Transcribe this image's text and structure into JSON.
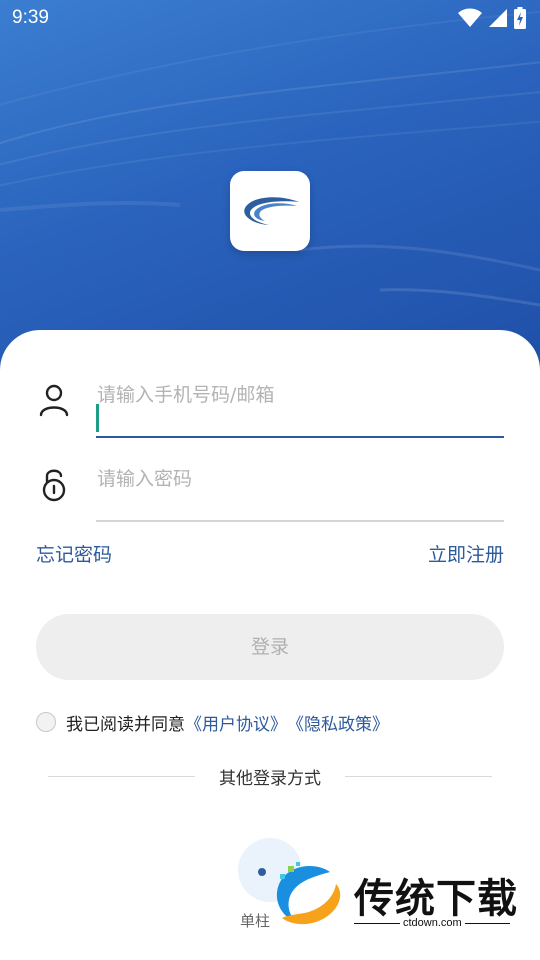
{
  "status_bar": {
    "time": "9:39"
  },
  "login": {
    "account_placeholder": "请输入手机号码/邮箱",
    "password_placeholder": "请输入密码",
    "forgot_password": "忘记密码",
    "register": "立即注册",
    "login_button": "登录",
    "agreement_prefix": "我已阅读并同意",
    "user_agreement": "《用户协议》",
    "privacy_policy": "《隐私政策》",
    "other_methods": "其他登录方式",
    "other_method_label": "单柱"
  },
  "watermark": {
    "brand": "传统下载",
    "domain": "ctdown.com"
  },
  "colors": {
    "primary": "#2d5a9c",
    "hero_top": "#3b7ed0",
    "hero_bottom": "#1f4fa8",
    "caret": "#1e9c86"
  }
}
